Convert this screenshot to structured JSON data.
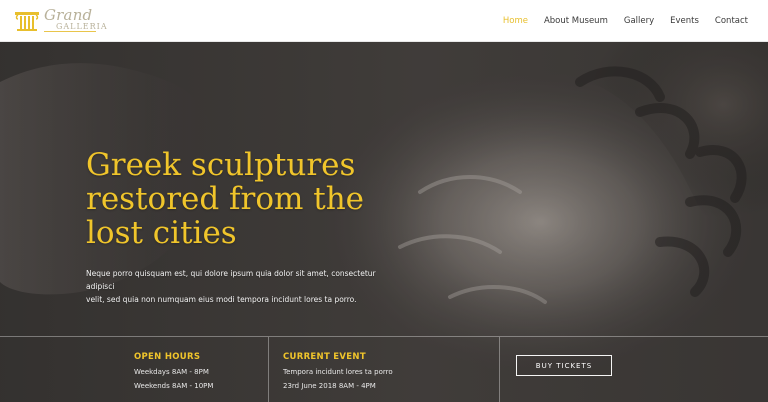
{
  "brand": {
    "title": "Grand",
    "subtitle": "GALLERIA",
    "icon": "pillar-logo-icon",
    "accent": "#e8bf2d"
  },
  "nav": {
    "items": [
      {
        "label": "Home",
        "active": true
      },
      {
        "label": "About Museum",
        "active": false
      },
      {
        "label": "Gallery",
        "active": false
      },
      {
        "label": "Events",
        "active": false
      },
      {
        "label": "Contact",
        "active": false
      }
    ]
  },
  "hero": {
    "title": "Greek sculptures\nrestored from the\nlost cities",
    "body": "Neque porro quisquam est, qui dolore ipsum quia dolor sit amet, consectetur adipisci\nvelit, sed quia non numquam eius modi tempora incidunt lores ta porro.",
    "title_color": "#f0c52b"
  },
  "info": {
    "open_hours": {
      "heading": "OPEN HOURS",
      "line1": "Weekdays 8AM - 8PM",
      "line2": "Weekends 8AM - 10PM"
    },
    "current_event": {
      "heading": "CURRENT EVENT",
      "line1": "Tempora incidunt lores ta porro",
      "line2": "23rd June 2018 8AM - 4PM"
    },
    "cta": {
      "label": "BUY TICKETS"
    }
  }
}
